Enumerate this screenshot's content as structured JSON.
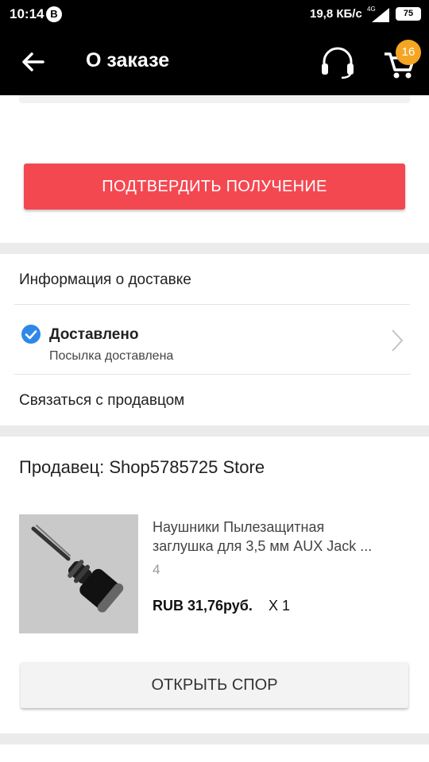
{
  "status_bar": {
    "time": "10:14",
    "notification_badge": "B",
    "net_speed": "19,8 КБ/с",
    "network": "4G",
    "battery": "75"
  },
  "app_bar": {
    "title": "О заказе",
    "cart_count": "16",
    "cart_badge_color": "#f4a623"
  },
  "actions": {
    "confirm_label": "ПОДТВЕРДИТЬ ПОЛУЧЕНИЕ",
    "confirm_color": "#f44851"
  },
  "delivery": {
    "heading": "Информация о доставке",
    "status_title": "Доставлено",
    "status_subtitle": "Посылка доставлена",
    "status_icon": "check-circle-icon",
    "status_icon_color": "#2f88e8",
    "contact_label": "Связаться с продавцом"
  },
  "order": {
    "seller": "Продавец: Shop5785725 Store",
    "product": {
      "title_line1": "Наушники Пылезащитная",
      "title_line2": "заглушка для 3,5 мм AUX Jack ...",
      "quantity_note": "4",
      "price": "RUB 31,76руб.",
      "multiplier": "X 1"
    },
    "dispute_label": "ОТКРЫТЬ СПОР"
  }
}
